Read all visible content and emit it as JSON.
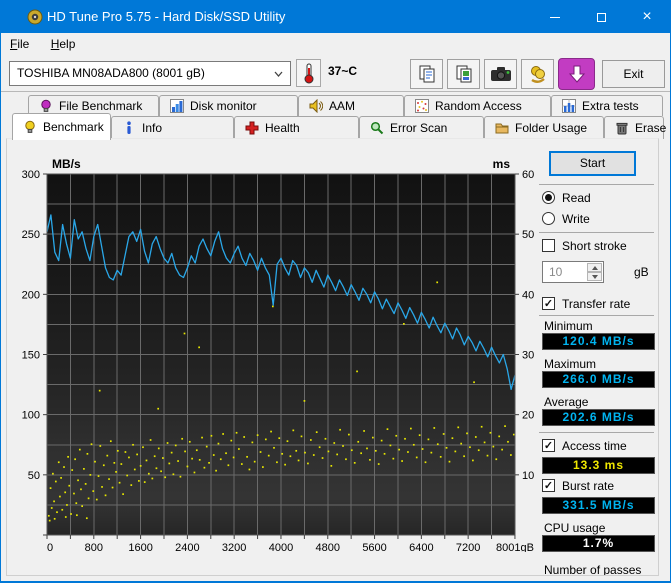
{
  "window": {
    "title": "HD Tune Pro 5.75 - Hard Disk/SSD Utility"
  },
  "menu": {
    "items": [
      {
        "initial": "F",
        "rest": "ile"
      },
      {
        "initial": "H",
        "rest": "elp"
      }
    ]
  },
  "toolbar": {
    "drive_select": "TOSHIBA MN08ADA800 (8001 gB)",
    "temperature": "37~C",
    "exit_label": "Exit",
    "icons": [
      "thermometer-icon",
      "copy-text-icon",
      "copy-image-icon",
      "screenshot-icon",
      "donate-icon",
      "update-icon"
    ]
  },
  "tabs": {
    "back": [
      "File Benchmark",
      "Disk monitor",
      "AAM",
      "Random Access",
      "Extra tests"
    ],
    "front": [
      "Benchmark",
      "Info",
      "Health",
      "Error Scan",
      "Folder Usage",
      "Erase"
    ],
    "active": "Benchmark"
  },
  "controls": {
    "start_label": "Start",
    "read_label": "Read",
    "write_label": "Write",
    "short_stroke_label": "Short stroke",
    "short_stroke_value": "10",
    "short_stroke_unit": "gB",
    "transfer_rate_label": "Transfer rate",
    "minimum_label": "Minimum",
    "minimum_value": "120.4 MB/s",
    "maximum_label": "Maximum",
    "maximum_value": "266.0 MB/s",
    "average_label": "Average",
    "average_value": "202.6 MB/s",
    "access_time_label": "Access time",
    "access_time_value": "13.3 ms",
    "burst_rate_label": "Burst rate",
    "burst_rate_value": "331.5 MB/s",
    "cpu_usage_label": "CPU usage",
    "cpu_usage_value": "1.7%",
    "passes_label": "Number of passes",
    "checkmark": "✓"
  },
  "chart_data": {
    "type": "line",
    "title": "",
    "left_axis": {
      "label": "MB/s",
      "min": 0,
      "max": 300,
      "tick_step": 50,
      "grid_step": 25
    },
    "right_axis": {
      "label": "ms",
      "min": 0,
      "max": 60,
      "tick_step": 10
    },
    "x_axis": {
      "min": 0,
      "max": 8001,
      "label_step": 800,
      "minor_step": 400,
      "last_label": "8001gB"
    },
    "grid": {
      "on": true,
      "color": "#6a6a6a"
    },
    "series": [
      {
        "name": "transfer-rate",
        "type": "line",
        "axis": "left",
        "unit": "MB/s",
        "color": "#2aa7e8",
        "x_step": 66.675,
        "values": [
          252,
          266,
          235,
          228,
          258,
          242,
          230,
          262,
          246,
          252,
          238,
          228,
          248,
          258,
          240,
          222,
          214,
          212,
          220,
          216,
          232,
          248,
          252,
          244,
          254,
          236,
          226,
          242,
          248,
          238,
          230,
          226,
          234,
          222,
          216,
          214,
          222,
          232,
          226,
          240,
          246,
          238,
          232,
          244,
          252,
          238,
          230,
          226,
          234,
          240,
          230,
          224,
          234,
          228,
          220,
          230,
          222,
          216,
          191,
          225,
          230,
          222,
          216,
          228,
          224,
          214,
          222,
          218,
          210,
          220,
          213,
          206,
          216,
          210,
          203,
          212,
          206,
          199,
          208,
          202,
          195,
          205,
          200,
          193,
          202,
          196,
          188,
          196,
          190,
          184,
          193,
          187,
          180,
          189,
          183,
          176,
          185,
          179,
          172,
          181,
          174,
          168,
          176,
          170,
          163,
          172,
          166,
          158,
          165,
          160,
          153,
          161,
          155,
          148,
          156,
          149,
          143,
          150,
          138,
          121,
          133
        ]
      },
      {
        "name": "access-time",
        "type": "scatter",
        "axis": "right",
        "unit": "ms",
        "color": "#e8e800",
        "points": [
          [
            30,
            3.2
          ],
          [
            45,
            2.4
          ],
          [
            60,
            7.8
          ],
          [
            80,
            4.5
          ],
          [
            100,
            10.2
          ],
          [
            120,
            5.6
          ],
          [
            130,
            2.7
          ],
          [
            150,
            8.9
          ],
          [
            170,
            3.8
          ],
          [
            200,
            12.1
          ],
          [
            220,
            6.4
          ],
          [
            240,
            9.5
          ],
          [
            260,
            4.2
          ],
          [
            290,
            11.3
          ],
          [
            310,
            7.1
          ],
          [
            320,
            3.0
          ],
          [
            340,
            5.0
          ],
          [
            360,
            13.0
          ],
          [
            380,
            8.2
          ],
          [
            410,
            3.5
          ],
          [
            430,
            10.8
          ],
          [
            460,
            6.9
          ],
          [
            480,
            12.6
          ],
          [
            500,
            5.3
          ],
          [
            510,
            3.3
          ],
          [
            530,
            9.1
          ],
          [
            560,
            14.2
          ],
          [
            580,
            7.6
          ],
          [
            600,
            4.8
          ],
          [
            630,
            11.0
          ],
          [
            660,
            8.5
          ],
          [
            680,
            2.8
          ],
          [
            690,
            13.5
          ],
          [
            710,
            6.1
          ],
          [
            740,
            10.0
          ],
          [
            760,
            15.1
          ],
          [
            790,
            7.3
          ],
          [
            820,
            12.2
          ],
          [
            850,
            5.9
          ],
          [
            880,
            9.8
          ],
          [
            900,
            24.0
          ],
          [
            910,
            14.8
          ],
          [
            940,
            8.0
          ],
          [
            970,
            11.6
          ],
          [
            1000,
            6.6
          ],
          [
            1030,
            13.2
          ],
          [
            1060,
            9.3
          ],
          [
            1090,
            15.6
          ],
          [
            1120,
            7.9
          ],
          [
            1150,
            12.0
          ],
          [
            1180,
            10.5
          ],
          [
            1210,
            14.0
          ],
          [
            1240,
            8.7
          ],
          [
            1270,
            11.8
          ],
          [
            1300,
            6.8
          ],
          [
            1340,
            13.8
          ],
          [
            1370,
            9.9
          ],
          [
            1400,
            12.9
          ],
          [
            1440,
            8.3
          ],
          [
            1470,
            15.0
          ],
          [
            1500,
            10.9
          ],
          [
            1540,
            13.4
          ],
          [
            1570,
            9.0
          ],
          [
            1600,
            11.5
          ],
          [
            1640,
            14.6
          ],
          [
            1670,
            8.8
          ],
          [
            1700,
            12.4
          ],
          [
            1740,
            10.2
          ],
          [
            1770,
            15.8
          ],
          [
            1800,
            9.4
          ],
          [
            1840,
            13.1
          ],
          [
            1870,
            11.1
          ],
          [
            1900,
            21.0
          ],
          [
            1910,
            14.4
          ],
          [
            1950,
            10.6
          ],
          [
            1980,
            12.8
          ],
          [
            2020,
            9.6
          ],
          [
            2060,
            15.3
          ],
          [
            2090,
            11.9
          ],
          [
            2130,
            13.7
          ],
          [
            2160,
            10.1
          ],
          [
            2200,
            14.9
          ],
          [
            2240,
            12.3
          ],
          [
            2280,
            9.7
          ],
          [
            2310,
            16.0
          ],
          [
            2350,
            33.5
          ],
          [
            2360,
            13.9
          ],
          [
            2400,
            11.4
          ],
          [
            2440,
            15.5
          ],
          [
            2480,
            12.7
          ],
          [
            2520,
            10.4
          ],
          [
            2560,
            14.1
          ],
          [
            2600,
            31.2
          ],
          [
            2610,
            12.5
          ],
          [
            2650,
            16.2
          ],
          [
            2690,
            11.2
          ],
          [
            2730,
            14.7
          ],
          [
            2770,
            12.0
          ],
          [
            2810,
            16.5
          ],
          [
            2850,
            13.3
          ],
          [
            2890,
            10.7
          ],
          [
            2930,
            15.2
          ],
          [
            2970,
            12.6
          ],
          [
            3010,
            16.8
          ],
          [
            3060,
            13.6
          ],
          [
            3100,
            11.6
          ],
          [
            3150,
            15.7
          ],
          [
            3190,
            12.9
          ],
          [
            3240,
            17.0
          ],
          [
            3280,
            14.3
          ],
          [
            3330,
            11.8
          ],
          [
            3370,
            16.3
          ],
          [
            3420,
            13.0
          ],
          [
            3460,
            10.9
          ],
          [
            3510,
            15.4
          ],
          [
            3550,
            12.2
          ],
          [
            3600,
            16.6
          ],
          [
            3650,
            13.8
          ],
          [
            3690,
            11.3
          ],
          [
            3740,
            15.9
          ],
          [
            3790,
            13.2
          ],
          [
            3830,
            17.2
          ],
          [
            3860,
            38.0
          ],
          [
            3880,
            14.5
          ],
          [
            3930,
            12.1
          ],
          [
            3970,
            16.1
          ],
          [
            4020,
            13.5
          ],
          [
            4070,
            11.7
          ],
          [
            4110,
            15.6
          ],
          [
            4160,
            13.1
          ],
          [
            4210,
            17.4
          ],
          [
            4260,
            14.0
          ],
          [
            4300,
            12.4
          ],
          [
            4350,
            16.4
          ],
          [
            4400,
            22.3
          ],
          [
            4410,
            13.7
          ],
          [
            4460,
            11.9
          ],
          [
            4510,
            15.8
          ],
          [
            4560,
            13.3
          ],
          [
            4610,
            17.1
          ],
          [
            4660,
            14.6
          ],
          [
            4710,
            12.8
          ],
          [
            4760,
            16.0
          ],
          [
            4810,
            13.9
          ],
          [
            4860,
            11.5
          ],
          [
            4910,
            15.3
          ],
          [
            4960,
            13.4
          ],
          [
            5010,
            17.5
          ],
          [
            5060,
            14.8
          ],
          [
            5110,
            12.6
          ],
          [
            5160,
            16.7
          ],
          [
            5210,
            14.1
          ],
          [
            5260,
            12.0
          ],
          [
            5300,
            27.2
          ],
          [
            5320,
            15.5
          ],
          [
            5370,
            13.6
          ],
          [
            5420,
            17.3
          ],
          [
            5470,
            14.4
          ],
          [
            5520,
            12.5
          ],
          [
            5570,
            16.2
          ],
          [
            5620,
            14.0
          ],
          [
            5670,
            11.8
          ],
          [
            5720,
            15.7
          ],
          [
            5770,
            13.5
          ],
          [
            5820,
            17.6
          ],
          [
            5870,
            14.9
          ],
          [
            5920,
            12.7
          ],
          [
            5970,
            16.5
          ],
          [
            6020,
            14.2
          ],
          [
            6070,
            12.3
          ],
          [
            6100,
            35.1
          ],
          [
            6120,
            16.0
          ],
          [
            6170,
            13.8
          ],
          [
            6220,
            17.7
          ],
          [
            6270,
            15.0
          ],
          [
            6320,
            12.9
          ],
          [
            6370,
            16.6
          ],
          [
            6420,
            14.3
          ],
          [
            6470,
            12.1
          ],
          [
            6520,
            15.9
          ],
          [
            6570,
            13.7
          ],
          [
            6620,
            17.8
          ],
          [
            6670,
            42.0
          ],
          [
            6680,
            15.1
          ],
          [
            6730,
            13.0
          ],
          [
            6780,
            16.8
          ],
          [
            6830,
            14.5
          ],
          [
            6880,
            12.2
          ],
          [
            6930,
            16.1
          ],
          [
            6980,
            13.9
          ],
          [
            7030,
            17.9
          ],
          [
            7080,
            15.2
          ],
          [
            7130,
            13.1
          ],
          [
            7180,
            16.9
          ],
          [
            7230,
            14.6
          ],
          [
            7280,
            12.4
          ],
          [
            7300,
            25.4
          ],
          [
            7330,
            16.3
          ],
          [
            7380,
            14.1
          ],
          [
            7430,
            18.0
          ],
          [
            7480,
            15.4
          ],
          [
            7530,
            13.2
          ],
          [
            7580,
            17.0
          ],
          [
            7630,
            14.7
          ],
          [
            7680,
            12.6
          ],
          [
            7730,
            16.4
          ],
          [
            7780,
            14.2
          ],
          [
            7830,
            18.1
          ],
          [
            7880,
            15.5
          ],
          [
            7930,
            13.3
          ],
          [
            7980,
            16.7
          ]
        ]
      }
    ]
  },
  "colors": {
    "titlebar": "#0078d7",
    "chart_line": "#2aa7e8",
    "chart_scatter": "#e8e800",
    "value_cyan": "#00b4f0",
    "value_yellow": "#f0e800",
    "grid": "#6a6a6a"
  }
}
